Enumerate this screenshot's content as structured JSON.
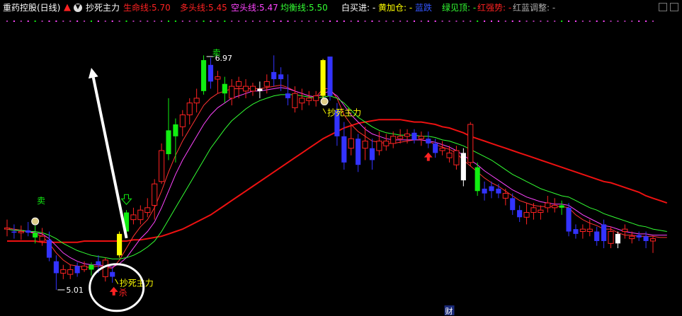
{
  "header": {
    "title": "重药控股(日线)",
    "indicator_name": "抄死主力",
    "lines": [
      {
        "label": "生命线:",
        "value": "5.70",
        "color": "#ff2222"
      },
      {
        "label": "多头线:",
        "value": "5.45",
        "color": "#ff2222"
      },
      {
        "label": "空头线:",
        "value": "5.47",
        "color": "#ff44ff"
      },
      {
        "label": "均衡线:",
        "value": "5.50",
        "color": "#33ff33"
      }
    ],
    "signals": [
      {
        "label": "白买进:",
        "value": "-",
        "color": "#ffffff"
      },
      {
        "label": "黄加仓:",
        "value": "-",
        "color": "#ffff00"
      },
      {
        "label": "蓝跌",
        "value": "",
        "color": "#3355ff"
      },
      {
        "label": "绿见顶:",
        "value": "-",
        "color": "#33ff33"
      },
      {
        "label": "红强势:",
        "value": "-",
        "color": "#ff2222"
      },
      {
        "label": "红蓝调整:",
        "value": "-",
        "color": "#aaaaaa"
      }
    ]
  },
  "annotations": {
    "sell_left": "卖",
    "sell_top": "卖",
    "high_price": "6.97",
    "low_price": "5.01",
    "kill": "杀",
    "chaosi_label": "抄死主力",
    "chaosi_label_2": "抄死主力",
    "finance_mark": "财"
  },
  "colors": {
    "up": "#ff2222",
    "down": "#3333ff",
    "buy_white": "#ffffff",
    "add_yellow": "#ffff00",
    "top_green": "#11ee11",
    "life_line": "#ee1111",
    "bull_line": "#ff3333",
    "bear_line": "#ff44ff",
    "balance_line": "#33ff33"
  },
  "chart_data": {
    "type": "candlestick",
    "price_range": [
      4.9,
      7.1
    ],
    "candles": [
      {
        "o": 5.53,
        "h": 5.6,
        "l": 5.46,
        "c": 5.52,
        "kind": "up"
      },
      {
        "o": 5.5,
        "h": 5.56,
        "l": 5.44,
        "c": 5.49,
        "kind": "down"
      },
      {
        "o": 5.49,
        "h": 5.55,
        "l": 5.43,
        "c": 5.5,
        "kind": "up"
      },
      {
        "o": 5.51,
        "h": 5.58,
        "l": 5.46,
        "c": 5.49,
        "kind": "down"
      },
      {
        "o": 5.49,
        "h": 5.55,
        "l": 5.4,
        "c": 5.45,
        "kind": "top"
      },
      {
        "o": 5.46,
        "h": 5.53,
        "l": 5.38,
        "c": 5.42,
        "kind": "up"
      },
      {
        "o": 5.43,
        "h": 5.5,
        "l": 5.25,
        "c": 5.28,
        "kind": "down"
      },
      {
        "o": 5.25,
        "h": 5.3,
        "l": 5.01,
        "c": 5.15,
        "kind": "down"
      },
      {
        "o": 5.15,
        "h": 5.22,
        "l": 5.1,
        "c": 5.18,
        "kind": "up"
      },
      {
        "o": 5.18,
        "h": 5.22,
        "l": 5.1,
        "c": 5.14,
        "kind": "up"
      },
      {
        "o": 5.15,
        "h": 5.24,
        "l": 5.12,
        "c": 5.21,
        "kind": "down"
      },
      {
        "o": 5.21,
        "h": 5.25,
        "l": 5.16,
        "c": 5.18,
        "kind": "up"
      },
      {
        "o": 5.18,
        "h": 5.24,
        "l": 5.13,
        "c": 5.22,
        "kind": "top"
      },
      {
        "o": 5.22,
        "h": 5.3,
        "l": 5.15,
        "c": 5.25,
        "kind": "down"
      },
      {
        "o": 5.26,
        "h": 5.28,
        "l": 5.08,
        "c": 5.12,
        "kind": "up"
      },
      {
        "o": 5.12,
        "h": 5.2,
        "l": 5.07,
        "c": 5.16,
        "kind": "down"
      },
      {
        "o": 5.3,
        "h": 5.5,
        "l": 5.28,
        "c": 5.48,
        "kind": "add"
      },
      {
        "o": 5.5,
        "h": 5.68,
        "l": 5.48,
        "c": 5.66,
        "kind": "top"
      },
      {
        "o": 5.64,
        "h": 5.7,
        "l": 5.56,
        "c": 5.6,
        "kind": "up"
      },
      {
        "o": 5.6,
        "h": 5.72,
        "l": 5.56,
        "c": 5.68,
        "kind": "up"
      },
      {
        "o": 5.66,
        "h": 5.78,
        "l": 5.62,
        "c": 5.7,
        "kind": "up"
      },
      {
        "o": 5.72,
        "h": 5.94,
        "l": 5.6,
        "c": 5.9,
        "kind": "up"
      },
      {
        "o": 5.92,
        "h": 6.24,
        "l": 5.9,
        "c": 6.18,
        "kind": "up"
      },
      {
        "o": 6.15,
        "h": 6.62,
        "l": 6.1,
        "c": 6.35,
        "kind": "top"
      },
      {
        "o": 6.3,
        "h": 6.45,
        "l": 6.08,
        "c": 6.4,
        "kind": "top"
      },
      {
        "o": 6.38,
        "h": 6.52,
        "l": 6.3,
        "c": 6.48,
        "kind": "up"
      },
      {
        "o": 6.48,
        "h": 6.62,
        "l": 6.4,
        "c": 6.58,
        "kind": "up"
      },
      {
        "o": 6.58,
        "h": 6.7,
        "l": 6.5,
        "c": 6.62,
        "kind": "up"
      },
      {
        "o": 6.68,
        "h": 6.98,
        "l": 6.65,
        "c": 6.94,
        "kind": "top"
      },
      {
        "o": 6.9,
        "h": 6.96,
        "l": 6.7,
        "c": 6.76,
        "kind": "down"
      },
      {
        "o": 6.78,
        "h": 6.85,
        "l": 6.66,
        "c": 6.8,
        "kind": "up"
      },
      {
        "o": 6.74,
        "h": 6.8,
        "l": 6.58,
        "c": 6.66,
        "kind": "top"
      },
      {
        "o": 6.62,
        "h": 6.78,
        "l": 6.56,
        "c": 6.72,
        "kind": "up"
      },
      {
        "o": 6.72,
        "h": 6.8,
        "l": 6.62,
        "c": 6.76,
        "kind": "up"
      },
      {
        "o": 6.72,
        "h": 6.78,
        "l": 6.62,
        "c": 6.68,
        "kind": "up"
      },
      {
        "o": 6.72,
        "h": 6.75,
        "l": 6.64,
        "c": 6.68,
        "kind": "up"
      },
      {
        "o": 6.68,
        "h": 6.76,
        "l": 6.62,
        "c": 6.7,
        "kind": "buy"
      },
      {
        "o": 6.72,
        "h": 6.82,
        "l": 6.66,
        "c": 6.76,
        "kind": "up"
      },
      {
        "o": 6.84,
        "h": 6.98,
        "l": 6.72,
        "c": 6.78,
        "kind": "down"
      },
      {
        "o": 6.78,
        "h": 6.88,
        "l": 6.68,
        "c": 6.82,
        "kind": "down"
      },
      {
        "o": 6.66,
        "h": 6.82,
        "l": 6.56,
        "c": 6.62,
        "kind": "down"
      },
      {
        "o": 6.66,
        "h": 6.72,
        "l": 6.5,
        "c": 6.54,
        "kind": "up"
      },
      {
        "o": 6.58,
        "h": 6.7,
        "l": 6.52,
        "c": 6.62,
        "kind": "up"
      },
      {
        "o": 6.62,
        "h": 6.68,
        "l": 6.56,
        "c": 6.6,
        "kind": "up"
      },
      {
        "o": 6.6,
        "h": 6.68,
        "l": 6.55,
        "c": 6.64,
        "kind": "up"
      },
      {
        "o": 6.64,
        "h": 6.95,
        "l": 6.62,
        "c": 6.94,
        "kind": "add"
      },
      {
        "o": 6.97,
        "h": 6.97,
        "l": 6.6,
        "c": 6.64,
        "kind": "down"
      },
      {
        "o": 6.52,
        "h": 6.58,
        "l": 6.22,
        "c": 6.3,
        "kind": "down"
      },
      {
        "o": 6.3,
        "h": 6.42,
        "l": 6.02,
        "c": 6.08,
        "kind": "down"
      },
      {
        "o": 6.28,
        "h": 6.4,
        "l": 6.14,
        "c": 6.2,
        "kind": "up"
      },
      {
        "o": 6.06,
        "h": 6.32,
        "l": 6.0,
        "c": 6.28,
        "kind": "down"
      },
      {
        "o": 6.26,
        "h": 6.38,
        "l": 6.1,
        "c": 6.2,
        "kind": "up"
      },
      {
        "o": 6.2,
        "h": 6.28,
        "l": 6.02,
        "c": 6.1,
        "kind": "down"
      },
      {
        "o": 6.18,
        "h": 6.34,
        "l": 6.14,
        "c": 6.26,
        "kind": "up"
      },
      {
        "o": 6.26,
        "h": 6.32,
        "l": 6.18,
        "c": 6.22,
        "kind": "up"
      },
      {
        "o": 6.24,
        "h": 6.34,
        "l": 6.2,
        "c": 6.3,
        "kind": "up"
      },
      {
        "o": 6.3,
        "h": 6.36,
        "l": 6.24,
        "c": 6.28,
        "kind": "up"
      },
      {
        "o": 6.3,
        "h": 6.36,
        "l": 6.24,
        "c": 6.32,
        "kind": "up"
      },
      {
        "o": 6.33,
        "h": 6.36,
        "l": 6.24,
        "c": 6.27,
        "kind": "down"
      },
      {
        "o": 6.28,
        "h": 6.34,
        "l": 6.22,
        "c": 6.3,
        "kind": "up"
      },
      {
        "o": 6.28,
        "h": 6.34,
        "l": 6.2,
        "c": 6.24,
        "kind": "down"
      },
      {
        "o": 6.24,
        "h": 6.28,
        "l": 6.12,
        "c": 6.16,
        "kind": "down"
      },
      {
        "o": 6.2,
        "h": 6.26,
        "l": 6.14,
        "c": 6.18,
        "kind": "up"
      },
      {
        "o": 6.16,
        "h": 6.22,
        "l": 6.08,
        "c": 6.12,
        "kind": "up"
      },
      {
        "o": 6.18,
        "h": 6.22,
        "l": 6.02,
        "c": 6.06,
        "kind": "up"
      },
      {
        "o": 6.16,
        "h": 6.2,
        "l": 5.88,
        "c": 5.93,
        "kind": "buy"
      },
      {
        "o": 6.4,
        "h": 6.42,
        "l": 6.05,
        "c": 6.08,
        "kind": "up"
      },
      {
        "o": 6.04,
        "h": 6.08,
        "l": 5.8,
        "c": 5.84,
        "kind": "top"
      },
      {
        "o": 5.86,
        "h": 5.92,
        "l": 5.76,
        "c": 5.82,
        "kind": "down"
      },
      {
        "o": 5.84,
        "h": 5.92,
        "l": 5.78,
        "c": 5.88,
        "kind": "down"
      },
      {
        "o": 5.86,
        "h": 5.9,
        "l": 5.78,
        "c": 5.82,
        "kind": "down"
      },
      {
        "o": 5.82,
        "h": 5.86,
        "l": 5.72,
        "c": 5.78,
        "kind": "up"
      },
      {
        "o": 5.78,
        "h": 5.82,
        "l": 5.64,
        "c": 5.68,
        "kind": "down"
      },
      {
        "o": 5.68,
        "h": 5.72,
        "l": 5.58,
        "c": 5.62,
        "kind": "down"
      },
      {
        "o": 5.62,
        "h": 5.74,
        "l": 5.56,
        "c": 5.66,
        "kind": "up"
      },
      {
        "o": 5.66,
        "h": 5.74,
        "l": 5.6,
        "c": 5.7,
        "kind": "up"
      },
      {
        "o": 5.66,
        "h": 5.72,
        "l": 5.6,
        "c": 5.68,
        "kind": "up"
      },
      {
        "o": 5.7,
        "h": 5.8,
        "l": 5.66,
        "c": 5.74,
        "kind": "up"
      },
      {
        "o": 5.72,
        "h": 5.78,
        "l": 5.66,
        "c": 5.7,
        "kind": "up"
      },
      {
        "o": 5.7,
        "h": 5.76,
        "l": 5.64,
        "c": 5.72,
        "kind": "top"
      },
      {
        "o": 5.7,
        "h": 5.74,
        "l": 5.46,
        "c": 5.5,
        "kind": "down"
      },
      {
        "o": 5.52,
        "h": 5.56,
        "l": 5.44,
        "c": 5.48,
        "kind": "down"
      },
      {
        "o": 5.5,
        "h": 5.56,
        "l": 5.44,
        "c": 5.52,
        "kind": "up"
      },
      {
        "o": 5.52,
        "h": 5.6,
        "l": 5.46,
        "c": 5.5,
        "kind": "up"
      },
      {
        "o": 5.5,
        "h": 5.54,
        "l": 5.38,
        "c": 5.42,
        "kind": "down"
      },
      {
        "o": 5.42,
        "h": 5.6,
        "l": 5.36,
        "c": 5.56,
        "kind": "down"
      },
      {
        "o": 5.5,
        "h": 5.54,
        "l": 5.36,
        "c": 5.4,
        "kind": "up"
      },
      {
        "o": 5.4,
        "h": 5.5,
        "l": 5.36,
        "c": 5.48,
        "kind": "buy"
      },
      {
        "o": 5.5,
        "h": 5.56,
        "l": 5.44,
        "c": 5.52,
        "kind": "up"
      },
      {
        "o": 5.46,
        "h": 5.5,
        "l": 5.4,
        "c": 5.44,
        "kind": "up"
      },
      {
        "o": 5.47,
        "h": 5.5,
        "l": 5.42,
        "c": 5.45,
        "kind": "down"
      },
      {
        "o": 5.42,
        "h": 5.5,
        "l": 5.36,
        "c": 5.46,
        "kind": "down"
      },
      {
        "o": 5.44,
        "h": 5.46,
        "l": 5.32,
        "c": 5.42,
        "kind": "up"
      }
    ],
    "series": [
      {
        "key": "life",
        "name": "生命线",
        "values": [
          5.42,
          5.42,
          5.42,
          5.42,
          5.42,
          5.41,
          5.41,
          5.41,
          5.41,
          5.41,
          5.41,
          5.42,
          5.42,
          5.42,
          5.42,
          5.42,
          5.42,
          5.42,
          5.43,
          5.43,
          5.44,
          5.45,
          5.46,
          5.48,
          5.5,
          5.52,
          5.55,
          5.58,
          5.61,
          5.64,
          5.68,
          5.72,
          5.76,
          5.8,
          5.84,
          5.88,
          5.92,
          5.96,
          6.0,
          6.04,
          6.08,
          6.12,
          6.16,
          6.2,
          6.24,
          6.28,
          6.31,
          6.34,
          6.37,
          6.39,
          6.41,
          6.42,
          6.43,
          6.44,
          6.44,
          6.44,
          6.44,
          6.43,
          6.42,
          6.42,
          6.41,
          6.4,
          6.38,
          6.37,
          6.35,
          6.33,
          6.3,
          6.28,
          6.26,
          6.24,
          6.22,
          6.2,
          6.18,
          6.16,
          6.14,
          6.12,
          6.1,
          6.08,
          6.06,
          6.04,
          6.02,
          6.0,
          5.98,
          5.96,
          5.94,
          5.92,
          5.91,
          5.89,
          5.87,
          5.85,
          5.83,
          5.8,
          5.78,
          5.76,
          5.74
        ]
      },
      {
        "key": "bull",
        "name": "多头线",
        "values": [
          5.53,
          5.52,
          5.51,
          5.5,
          5.48,
          5.46,
          5.4,
          5.32,
          5.26,
          5.22,
          5.21,
          5.2,
          5.2,
          5.21,
          5.2,
          5.19,
          5.26,
          5.36,
          5.46,
          5.54,
          5.6,
          5.7,
          5.84,
          6.0,
          6.14,
          6.26,
          6.36,
          6.46,
          6.56,
          6.62,
          6.66,
          6.68,
          6.7,
          6.7,
          6.7,
          6.7,
          6.7,
          6.71,
          6.72,
          6.73,
          6.71,
          6.68,
          6.66,
          6.64,
          6.63,
          6.7,
          6.7,
          6.62,
          6.48,
          6.4,
          6.34,
          6.3,
          6.26,
          6.25,
          6.24,
          6.24,
          6.25,
          6.26,
          6.27,
          6.27,
          6.26,
          6.23,
          6.21,
          6.19,
          6.16,
          6.1,
          6.05,
          6.0,
          5.95,
          5.91,
          5.88,
          5.84,
          5.8,
          5.76,
          5.74,
          5.72,
          5.71,
          5.71,
          5.71,
          5.71,
          5.7,
          5.64,
          5.6,
          5.57,
          5.55,
          5.52,
          5.52,
          5.49,
          5.47,
          5.47,
          5.46,
          5.46,
          5.46,
          5.45,
          5.45
        ]
      },
      {
        "key": "bear",
        "name": "空头线",
        "values": [
          5.52,
          5.51,
          5.51,
          5.5,
          5.49,
          5.48,
          5.44,
          5.38,
          5.32,
          5.28,
          5.25,
          5.23,
          5.22,
          5.22,
          5.21,
          5.2,
          5.23,
          5.28,
          5.36,
          5.44,
          5.5,
          5.58,
          5.7,
          5.84,
          5.98,
          6.1,
          6.2,
          6.3,
          6.4,
          6.48,
          6.54,
          6.58,
          6.62,
          6.64,
          6.66,
          6.68,
          6.68,
          6.69,
          6.7,
          6.71,
          6.7,
          6.68,
          6.66,
          6.64,
          6.63,
          6.66,
          6.68,
          6.64,
          6.56,
          6.48,
          6.42,
          6.36,
          6.32,
          6.3,
          6.28,
          6.27,
          6.27,
          6.27,
          6.27,
          6.27,
          6.26,
          6.25,
          6.23,
          6.21,
          6.18,
          6.14,
          6.1,
          6.06,
          6.01,
          5.97,
          5.93,
          5.89,
          5.85,
          5.82,
          5.79,
          5.77,
          5.75,
          5.74,
          5.73,
          5.73,
          5.72,
          5.68,
          5.64,
          5.61,
          5.58,
          5.55,
          5.54,
          5.52,
          5.5,
          5.49,
          5.48,
          5.48,
          5.47,
          5.47,
          5.47
        ]
      },
      {
        "key": "balance",
        "name": "均衡线",
        "values": [
          5.52,
          5.51,
          5.51,
          5.5,
          5.5,
          5.49,
          5.47,
          5.44,
          5.4,
          5.37,
          5.34,
          5.32,
          5.3,
          5.29,
          5.28,
          5.27,
          5.27,
          5.28,
          5.3,
          5.33,
          5.37,
          5.42,
          5.5,
          5.6,
          5.7,
          5.8,
          5.9,
          6.0,
          6.1,
          6.2,
          6.28,
          6.36,
          6.43,
          6.48,
          6.53,
          6.57,
          6.6,
          6.62,
          6.64,
          6.65,
          6.65,
          6.65,
          6.64,
          6.63,
          6.62,
          6.63,
          6.64,
          6.62,
          6.58,
          6.52,
          6.46,
          6.42,
          6.38,
          6.35,
          6.33,
          6.32,
          6.31,
          6.31,
          6.31,
          6.3,
          6.3,
          6.29,
          6.27,
          6.26,
          6.24,
          6.22,
          6.19,
          6.16,
          6.13,
          6.1,
          6.06,
          6.02,
          5.98,
          5.95,
          5.92,
          5.89,
          5.86,
          5.84,
          5.82,
          5.8,
          5.79,
          5.76,
          5.73,
          5.7,
          5.68,
          5.65,
          5.63,
          5.61,
          5.59,
          5.57,
          5.55,
          5.54,
          5.52,
          5.51,
          5.5
        ]
      }
    ]
  }
}
